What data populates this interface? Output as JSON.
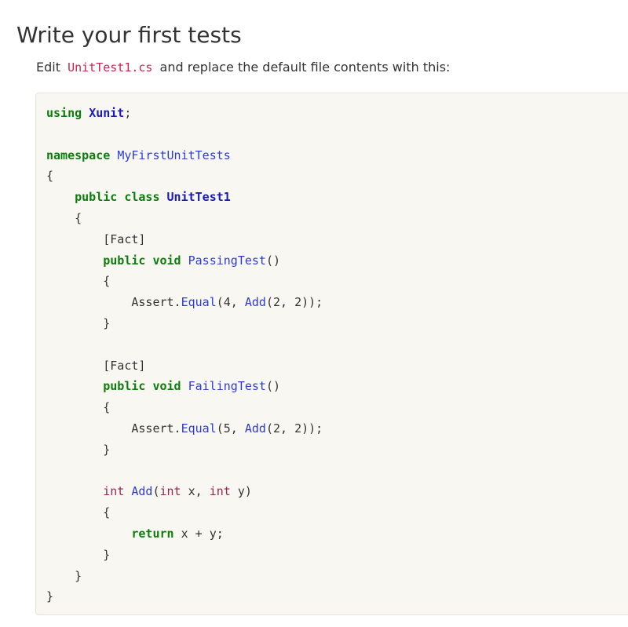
{
  "heading": "Write your first tests",
  "intro": {
    "before": "Edit",
    "file": "UnitTest1.cs",
    "after": "and replace the default file contents with this:"
  },
  "code": {
    "language": "csharp",
    "lines": [
      [
        {
          "t": "using",
          "c": "kw"
        },
        {
          "t": " "
        },
        {
          "t": "Xunit",
          "c": "ty"
        },
        {
          "t": ";"
        }
      ],
      [],
      [
        {
          "t": "namespace",
          "c": "kw"
        },
        {
          "t": " "
        },
        {
          "t": "MyFirstUnitTests",
          "c": "fn"
        }
      ],
      [
        {
          "t": "{"
        }
      ],
      [
        {
          "t": "    "
        },
        {
          "t": "public",
          "c": "kw"
        },
        {
          "t": " "
        },
        {
          "t": "class",
          "c": "kw"
        },
        {
          "t": " "
        },
        {
          "t": "UnitTest1",
          "c": "ty"
        }
      ],
      [
        {
          "t": "    {"
        }
      ],
      [
        {
          "t": "        [Fact]"
        }
      ],
      [
        {
          "t": "        "
        },
        {
          "t": "public",
          "c": "kw"
        },
        {
          "t": " "
        },
        {
          "t": "void",
          "c": "kw"
        },
        {
          "t": " "
        },
        {
          "t": "PassingTest",
          "c": "fn"
        },
        {
          "t": "()"
        }
      ],
      [
        {
          "t": "        {"
        }
      ],
      [
        {
          "t": "            Assert."
        },
        {
          "t": "Equal",
          "c": "fn"
        },
        {
          "t": "(4, "
        },
        {
          "t": "Add",
          "c": "fn"
        },
        {
          "t": "(2, 2));"
        }
      ],
      [
        {
          "t": "        }"
        }
      ],
      [],
      [
        {
          "t": "        [Fact]"
        }
      ],
      [
        {
          "t": "        "
        },
        {
          "t": "public",
          "c": "kw"
        },
        {
          "t": " "
        },
        {
          "t": "void",
          "c": "kw"
        },
        {
          "t": " "
        },
        {
          "t": "FailingTest",
          "c": "fn"
        },
        {
          "t": "()"
        }
      ],
      [
        {
          "t": "        {"
        }
      ],
      [
        {
          "t": "            Assert."
        },
        {
          "t": "Equal",
          "c": "fn"
        },
        {
          "t": "(5, "
        },
        {
          "t": "Add",
          "c": "fn"
        },
        {
          "t": "(2, 2));"
        }
      ],
      [
        {
          "t": "        }"
        }
      ],
      [],
      [
        {
          "t": "        "
        },
        {
          "t": "int",
          "c": "kw-type"
        },
        {
          "t": " "
        },
        {
          "t": "Add",
          "c": "fn"
        },
        {
          "t": "("
        },
        {
          "t": "int",
          "c": "kw-type"
        },
        {
          "t": " x, "
        },
        {
          "t": "int",
          "c": "kw-type"
        },
        {
          "t": " y)"
        }
      ],
      [
        {
          "t": "        {"
        }
      ],
      [
        {
          "t": "            "
        },
        {
          "t": "return",
          "c": "kw"
        },
        {
          "t": " x + y;"
        }
      ],
      [
        {
          "t": "        }"
        }
      ],
      [
        {
          "t": "    }"
        }
      ],
      [
        {
          "t": "}"
        }
      ]
    ]
  }
}
